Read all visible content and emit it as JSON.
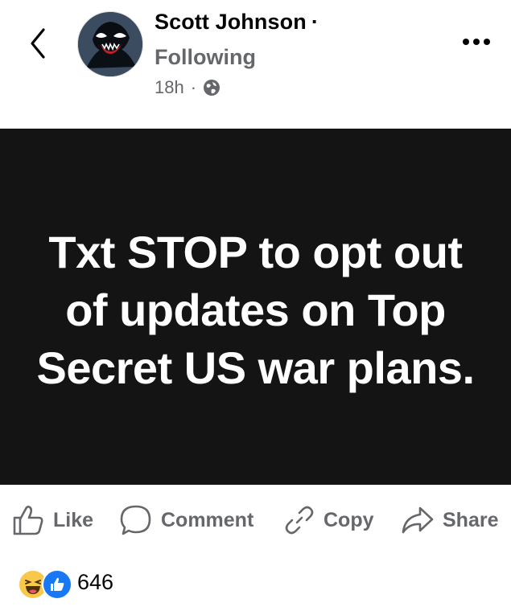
{
  "header": {
    "author_name": "Scott Johnson",
    "author_separator": "·",
    "follow_status": "Following",
    "timestamp": "18h",
    "meta_separator": "·",
    "back_icon": "chevron-left-icon",
    "more_icon": "more-horizontal-icon",
    "audience_icon": "globe-icon"
  },
  "post": {
    "text": "Txt STOP to opt out of updates on Top Secret US war plans.",
    "background": "#141414",
    "text_color": "#ffffff"
  },
  "actions": {
    "like_label": "Like",
    "comment_label": "Comment",
    "copy_label": "Copy",
    "share_label": "Share"
  },
  "reactions": {
    "types": [
      "haha",
      "like"
    ],
    "count": "646"
  },
  "colors": {
    "secondary_text": "#65676b",
    "like_blue": "#1877f2",
    "haha_yellow": "#f7c84a"
  }
}
